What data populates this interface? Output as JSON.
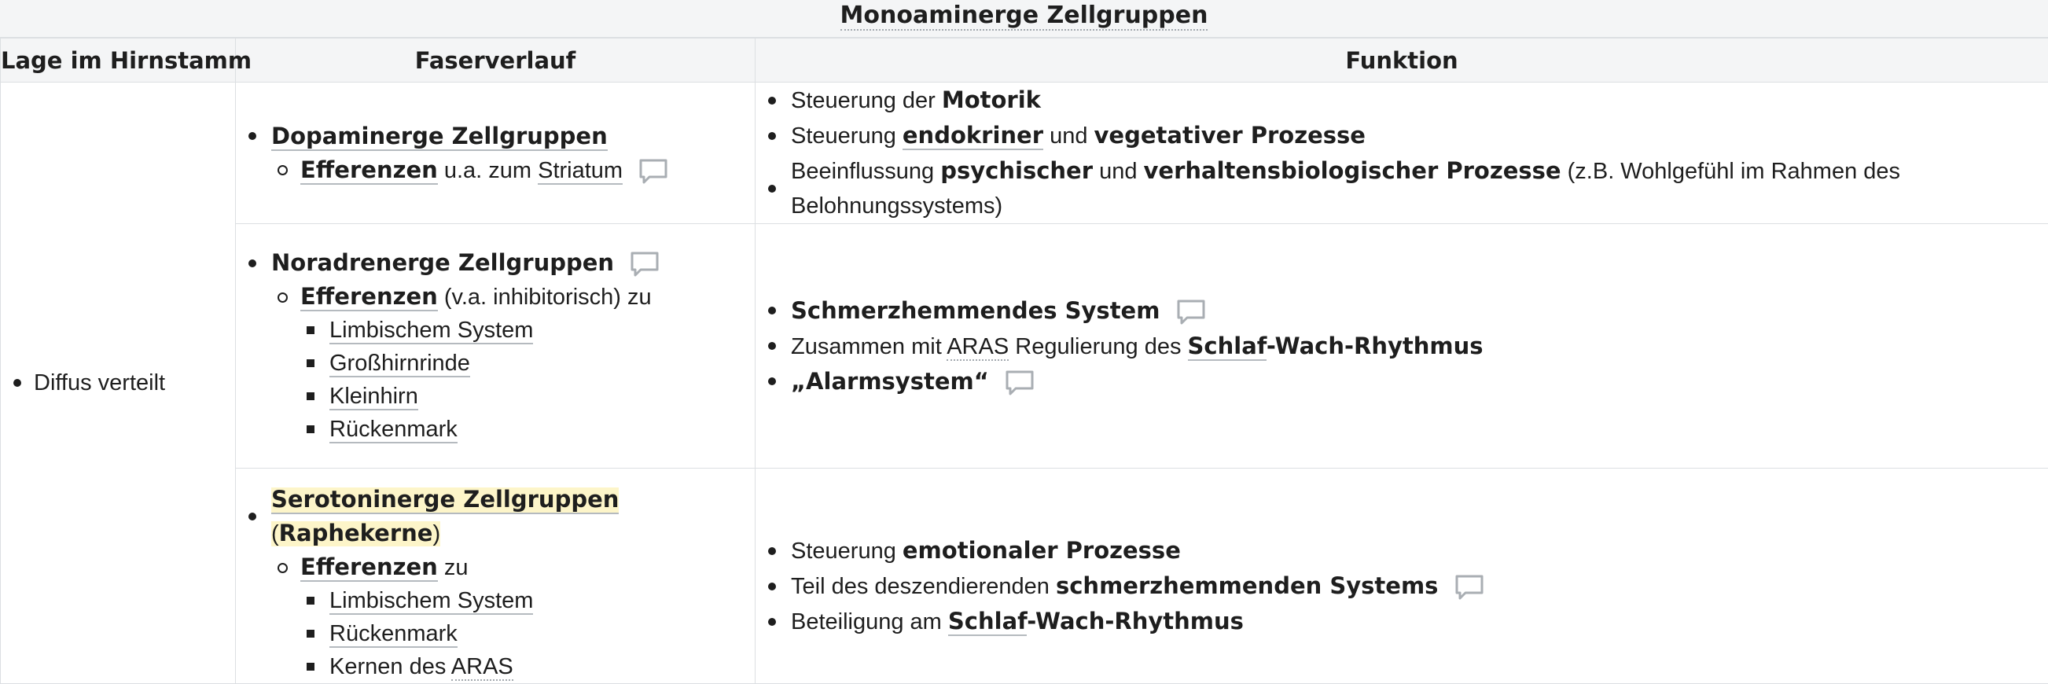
{
  "table": {
    "caption": "Monoaminerge Zellgruppen",
    "headers": [
      "Lage im Hirnstamm",
      "Faserverlauf",
      "Funktion"
    ],
    "lage": "Diffus verteilt",
    "rows": [
      {
        "group": "Dopaminerge Zellgruppen",
        "efferenzen": "Efferenzen",
        "efferenzen_rest": " u.a. zum ",
        "target": "Striatum",
        "funktion": [
          {
            "pre": "Steuerung der ",
            "bold": "Motorik"
          },
          {
            "pre": "Steuerung ",
            "bold": "endokriner",
            "mid": " und ",
            "bold2": "vegetativer Prozesse"
          },
          {
            "pre": "Beeinflussung ",
            "bold": "psychischer",
            "mid": " und ",
            "bold2": "verhaltensbiologischer Prozesse",
            "post": " (z.B. Wohlgefühl im Rahmen des Belohnungssystems)"
          }
        ]
      },
      {
        "group": "Noradrenerge Zellgruppen",
        "efferenzen": "Efferenzen",
        "efferenzen_rest": " (v.a. inhibitorisch) zu",
        "targets": [
          "Limbischem System",
          "Großhirnrinde",
          "Kleinhirn",
          "Rückenmark"
        ],
        "funktion": [
          {
            "bold": "Schmerzhemmendes System"
          },
          {
            "pre": "Zusammen mit ",
            "link": "ARAS",
            "mid": " Regulierung des ",
            "bold": "Schlaf",
            "bold2": "-Wach-Rhythmus"
          },
          {
            "bold": "„Alarmsystem“"
          }
        ]
      },
      {
        "group": "Serotoninerge Zellgruppen",
        "group_paren_open": " (",
        "group_sub": "Raphekerne",
        "group_paren_close": ")",
        "efferenzen": "Efferenzen",
        "efferenzen_rest": " zu",
        "targets": [
          "Limbischem System",
          "Rückenmark"
        ],
        "target_last_pre": "Kernen des ",
        "target_last_link": "ARAS",
        "funktion": [
          {
            "pre": "Steuerung ",
            "bold": "emotionaler Prozesse"
          },
          {
            "pre": "Teil des deszendierenden ",
            "bold": "schmerzhemmenden Systems"
          },
          {
            "pre": "Beteiligung am ",
            "bold": "Schlaf",
            "bold2": "-Wach-Rhythmus"
          }
        ]
      }
    ],
    "icons": {
      "comment": "speech-bubble-icon"
    }
  }
}
